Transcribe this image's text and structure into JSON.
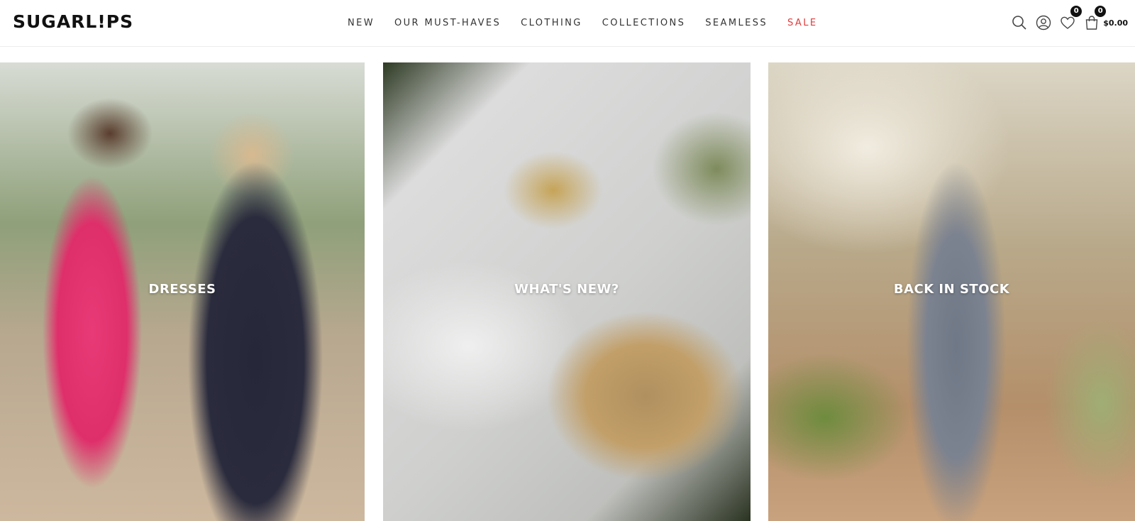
{
  "brand": {
    "logo_text": "SUGARL!PS"
  },
  "nav": {
    "items": [
      {
        "label": "NEW"
      },
      {
        "label": "OUR MUST-HAVES"
      },
      {
        "label": "CLOTHING"
      },
      {
        "label": "COLLECTIONS"
      },
      {
        "label": "SEAMLESS"
      },
      {
        "label": "SALE"
      }
    ],
    "sale_color": "#e03b3b"
  },
  "header_icons": {
    "search_icon": "search-icon",
    "account_icon": "user-icon",
    "wishlist_icon": "heart-icon",
    "wishlist_count": "0",
    "cart_icon": "shopping-bag-icon",
    "cart_count": "0",
    "cart_total": "$0.00"
  },
  "tiles": [
    {
      "label": "DRESSES"
    },
    {
      "label": "WHAT'S NEW?"
    },
    {
      "label": "BACK IN STOCK"
    }
  ]
}
